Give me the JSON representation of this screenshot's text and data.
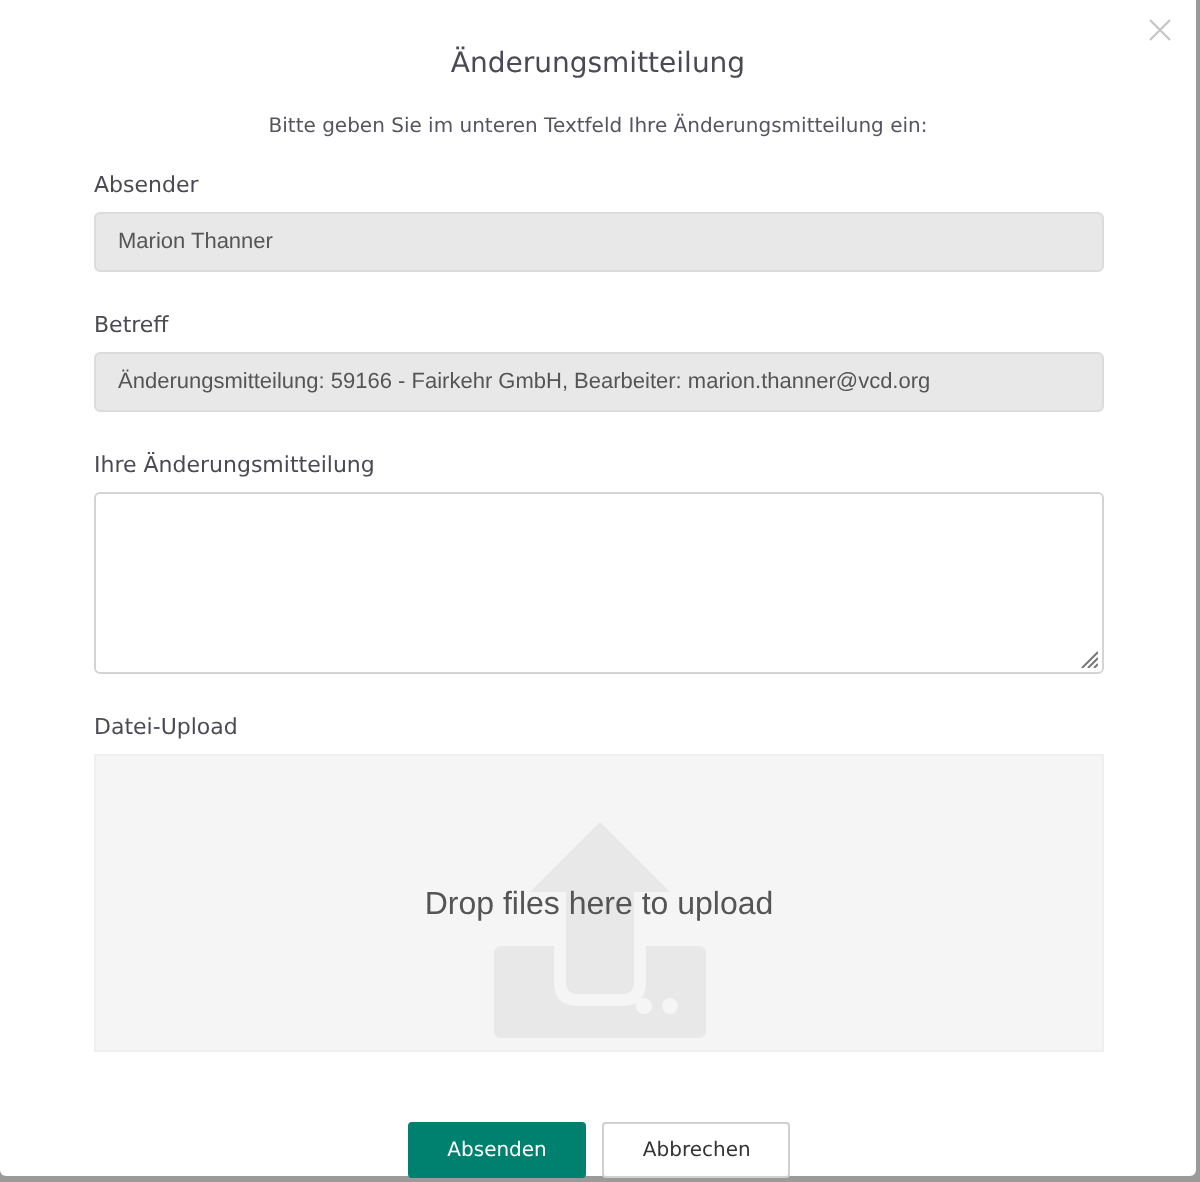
{
  "dialog": {
    "title": "Änderungsmitteilung",
    "intro": "Bitte geben Sie im unteren Textfeld Ihre Änderungsmitteilung ein:"
  },
  "fields": [
    {
      "kind": "readonly",
      "label": "Absender",
      "value": "Marion Thanner"
    },
    {
      "kind": "readonly",
      "label": "Betreff",
      "value": "Änderungsmitteilung: 59166 - Fairkehr GmbH, Bearbeiter: marion.thanner@vcd.org"
    },
    {
      "kind": "textarea",
      "label": "Ihre Änderungsmitteilung"
    },
    {
      "kind": "upload",
      "label": "Datei-Upload",
      "prompt": "Drop files here to upload"
    }
  ],
  "buttons": [
    {
      "label": "Absenden",
      "kind": "primary"
    },
    {
      "label": "Abbrechen",
      "kind": "secondary"
    }
  ]
}
